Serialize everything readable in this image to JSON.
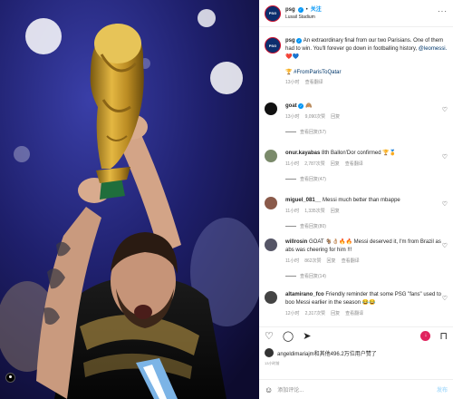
{
  "header": {
    "username": "psg",
    "follow_label": "关注",
    "location": "Lusail Stadium",
    "more_icon": "more-icon"
  },
  "caption": {
    "username": "psg",
    "text": "An extraordinary final from our two Parisians. One of them had to win. You'll forever go down in footballing history,",
    "mention": "@leomessi.",
    "emoji": "❤️💙",
    "hashtag_emoji": "🏆",
    "hashtag": "#FromParisToQatar",
    "time": "13小时",
    "translate": "查看翻译"
  },
  "comments": [
    {
      "username": "goat",
      "text": "🙈",
      "time": "13小时",
      "likes": "9,090次赞",
      "reply": "回复",
      "translate": "",
      "view_replies": "查看回复(57)"
    },
    {
      "username": "onur.kayabas",
      "text": "8th Ballon'Dor confirmed 🏆🏅",
      "time": "11小时",
      "likes": "2,787次赞",
      "reply": "回复",
      "translate": "查看翻译",
      "view_replies": "查看回复(47)"
    },
    {
      "username": "miguel_081__",
      "text": "Messi much better than mbappe",
      "time": "11小时",
      "likes": "1,335次赞",
      "reply": "回复",
      "translate": "",
      "view_replies": "查看回复(80)"
    },
    {
      "username": "willrosin",
      "text": "GOAT 🐐👌🏼🔥🔥 Messi deserved it, I'm from Brazil as abs was cheering for him !!!",
      "time": "11小时",
      "likes": "862次赞",
      "reply": "回复",
      "translate": "查看翻译",
      "view_replies": "查看回复(14)"
    },
    {
      "username": "altamirano_fco",
      "text": "Friendly reminder that some PSG \"fans\" used to boo Messi earlier in the season 😂😂",
      "time": "12小时",
      "likes": "2,317次赞",
      "reply": "回复",
      "translate": "查看翻译",
      "view_replies": ""
    }
  ],
  "actions": {
    "like_icon": "heart-icon",
    "comment_icon": "comment-icon",
    "share_icon": "share-icon",
    "save_icon": "bookmark-icon"
  },
  "likes_line": "angeldimariajm和其他496.2万位用户赞了",
  "post_time": "13小时前",
  "add_comment": {
    "placeholder": "添加评论...",
    "post_label": "发布"
  },
  "colors": {
    "accent": "#0095f6",
    "psg_navy": "#0c2e6e",
    "psg_red": "#c8102e"
  }
}
